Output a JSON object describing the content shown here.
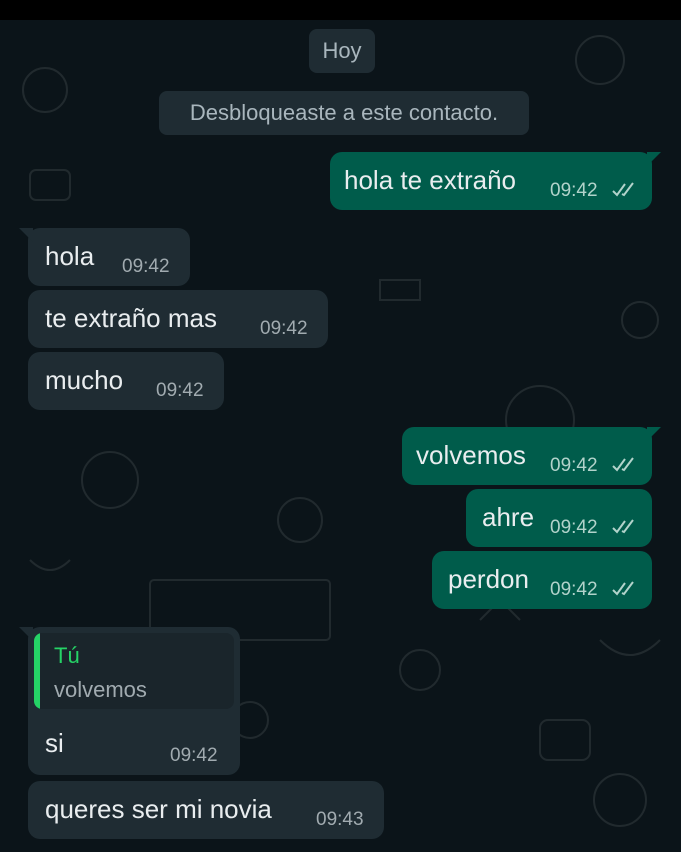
{
  "date_chip": "Hoy",
  "system_message": "Desbloqueaste a este contacto.",
  "messages": [
    {
      "text": "hola te extraño",
      "time": "09:42",
      "direction": "out",
      "status": "read-ticks"
    },
    {
      "text": "hola",
      "time": "09:42",
      "direction": "in"
    },
    {
      "text": "te extraño mas",
      "time": "09:42",
      "direction": "in"
    },
    {
      "text": "mucho",
      "time": "09:42",
      "direction": "in"
    },
    {
      "text": "volvemos",
      "time": "09:42",
      "direction": "out",
      "status": "read-ticks"
    },
    {
      "text": "ahre",
      "time": "09:42",
      "direction": "out",
      "status": "read-ticks"
    },
    {
      "text": "perdon",
      "time": "09:42",
      "direction": "out",
      "status": "read-ticks"
    },
    {
      "quote_author": "Tú",
      "quote_text": "volvemos",
      "text": "si",
      "time": "09:42",
      "direction": "in"
    },
    {
      "text": "queres ser mi novia",
      "time": "09:43",
      "direction": "in"
    }
  ],
  "colors": {
    "background": "#0b1419",
    "incoming_bubble": "#1f2c33",
    "outgoing_bubble": "#005c4b",
    "quote_accent": "#25d366"
  }
}
